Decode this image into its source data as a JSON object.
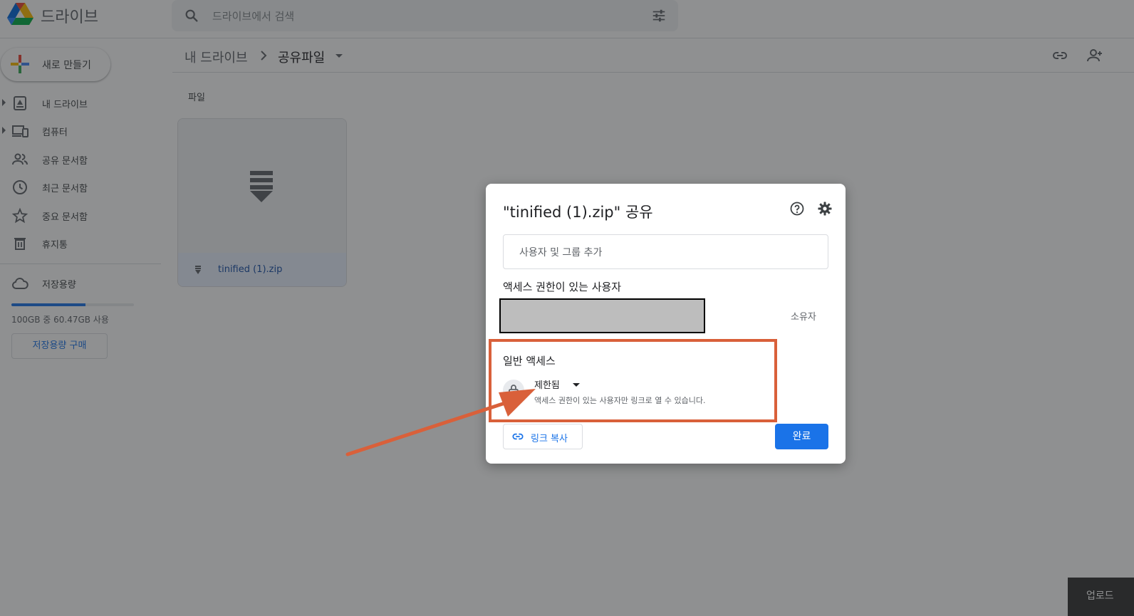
{
  "app": {
    "title": "드라이브"
  },
  "search": {
    "placeholder": "드라이브에서 검색"
  },
  "sidebar": {
    "new_button": "새로 만들기",
    "items": [
      {
        "label": "내 드라이브",
        "icon": "drive-icon"
      },
      {
        "label": "컴퓨터",
        "icon": "computer-icon"
      },
      {
        "label": "공유 문서함",
        "icon": "people-icon"
      },
      {
        "label": "최근 문서함",
        "icon": "clock-icon"
      },
      {
        "label": "중요 문서함",
        "icon": "star-icon"
      },
      {
        "label": "휴지통",
        "icon": "trash-icon"
      }
    ],
    "storage": {
      "label": "저장용량",
      "usage_text": "100GB 중 60.47GB 사용",
      "used_fraction": 0.6047,
      "buy_button": "저장용량 구매"
    }
  },
  "breadcrumb": {
    "root": "내 드라이브",
    "current": "공유파일"
  },
  "main": {
    "section_label": "파일",
    "files": [
      {
        "name": "tinified (1).zip",
        "icon": "zip-icon"
      }
    ]
  },
  "share_dialog": {
    "title": "\"tinified (1).zip\" 공유",
    "add_placeholder": "사용자 및 그룹 추가",
    "people_label": "액세스 권한이 있는 사용자",
    "owner_role": "소유자",
    "general_access_label": "일반 액세스",
    "access_level": "제한됨",
    "access_description": "액세스 권한이 있는 사용자만 링크로 열 수 있습니다.",
    "copy_link": "링크 복사",
    "done": "완료"
  },
  "upload_tab": {
    "label": "업로드"
  },
  "colors": {
    "accent": "#1a73e8",
    "annotation": "#d9603a"
  }
}
